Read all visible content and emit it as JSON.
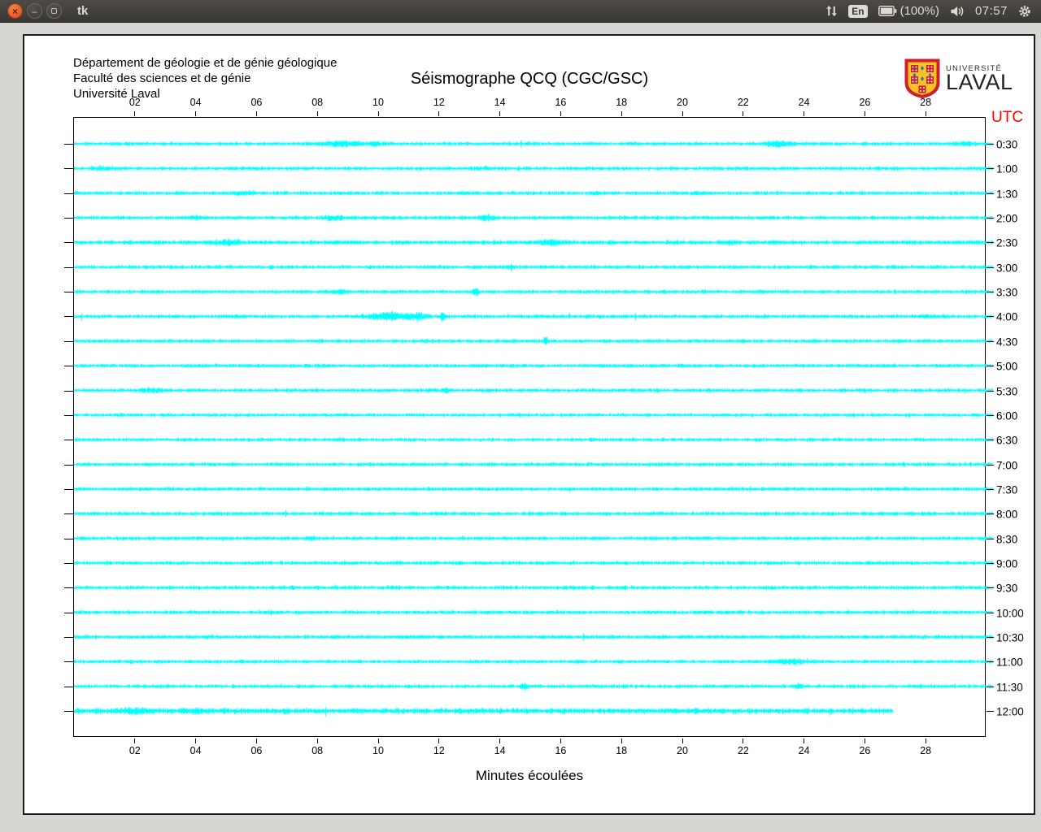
{
  "panel": {
    "title": "tk",
    "indicators": {
      "keyboard": "En",
      "battery": "(100%)",
      "clock": "07:57"
    }
  },
  "header": {
    "line1": "Département de géologie et de génie géologique",
    "line2": "Faculté des sciences et de génie",
    "line3": "Université Laval"
  },
  "logo": {
    "line1": "UNIVERSITÉ",
    "line2": "LAVAL"
  },
  "chart_data": {
    "type": "line",
    "title": "Séismographe QCQ (CGC/GSC)",
    "xlabel": "Minutes écoulées",
    "right_axis_label": "UTC",
    "right_axis_label_color": "#ff0000",
    "x_range": [
      0,
      30
    ],
    "trace_color": "#00ffff",
    "x_ticks": [
      {
        "m": 2,
        "label": "02"
      },
      {
        "m": 4,
        "label": "04"
      },
      {
        "m": 6,
        "label": "06"
      },
      {
        "m": 8,
        "label": "08"
      },
      {
        "m": 10,
        "label": "10"
      },
      {
        "m": 12,
        "label": "12"
      },
      {
        "m": 14,
        "label": "14"
      },
      {
        "m": 16,
        "label": "16"
      },
      {
        "m": 18,
        "label": "18"
      },
      {
        "m": 20,
        "label": "20"
      },
      {
        "m": 22,
        "label": "22"
      },
      {
        "m": 24,
        "label": "24"
      },
      {
        "m": 26,
        "label": "26"
      },
      {
        "m": 28,
        "label": "28"
      }
    ],
    "traces": [
      {
        "label": "0:30",
        "end": 30.2,
        "scale": 1,
        "events": [
          [
            8.7,
            3,
            0.5
          ],
          [
            9.9,
            2,
            0.25
          ],
          [
            23.2,
            3,
            0.4
          ],
          [
            29.3,
            2,
            0.25
          ]
        ]
      },
      {
        "label": "1:00",
        "end": 30.2,
        "scale": 1,
        "events": [
          [
            1.0,
            1.5,
            0.3
          ],
          [
            13.5,
            1.2,
            0.2
          ]
        ]
      },
      {
        "label": "1:30",
        "end": 30.2,
        "scale": 1,
        "events": [
          [
            5.6,
            2,
            0.25
          ],
          [
            17.2,
            1.5,
            0.15
          ],
          [
            20.6,
            1.5,
            0.15
          ]
        ]
      },
      {
        "label": "2:00",
        "end": 30.2,
        "scale": 1,
        "events": [
          [
            4.0,
            2,
            0.2
          ],
          [
            8.5,
            2.5,
            0.25
          ],
          [
            13.6,
            2.5,
            0.2
          ]
        ]
      },
      {
        "label": "2:30",
        "end": 30.2,
        "scale": 1.1,
        "events": [
          [
            5.0,
            2.5,
            0.3
          ],
          [
            8.6,
            1.5,
            0.2
          ],
          [
            15.7,
            3.5,
            0.3
          ],
          [
            21.5,
            1.5,
            0.2
          ]
        ]
      },
      {
        "label": "3:00",
        "end": 30.2,
        "scale": 1,
        "events": [
          [
            14.3,
            1.5,
            0.15
          ]
        ]
      },
      {
        "label": "3:30",
        "end": 30.2,
        "scale": 1,
        "events": [
          [
            8.7,
            2,
            0.2
          ],
          [
            13.2,
            7,
            0.06
          ]
        ]
      },
      {
        "label": "4:00",
        "end": 30.2,
        "scale": 1,
        "events": [
          [
            10.3,
            5,
            0.45
          ],
          [
            11.3,
            5,
            0.2
          ],
          [
            12.1,
            6,
            0.05
          ],
          [
            28.0,
            2,
            0.15
          ]
        ]
      },
      {
        "label": "4:30",
        "end": 30.2,
        "scale": 1,
        "events": [
          [
            15.5,
            7,
            0.05
          ]
        ]
      },
      {
        "label": "5:00",
        "end": 30.2,
        "scale": 1,
        "events": []
      },
      {
        "label": "5:30",
        "end": 30.2,
        "scale": 1,
        "events": [
          [
            2.4,
            2.5,
            0.3
          ],
          [
            12.2,
            1.8,
            0.15
          ]
        ]
      },
      {
        "label": "6:00",
        "end": 30.2,
        "scale": 0.95,
        "events": []
      },
      {
        "label": "6:30",
        "end": 30.2,
        "scale": 0.95,
        "events": []
      },
      {
        "label": "7:00",
        "end": 30.2,
        "scale": 1,
        "events": []
      },
      {
        "label": "7:30",
        "end": 30.2,
        "scale": 1,
        "events": []
      },
      {
        "label": "8:00",
        "end": 30.2,
        "scale": 1.05,
        "events": []
      },
      {
        "label": "8:30",
        "end": 30.2,
        "scale": 1,
        "events": [
          [
            7.8,
            1.5,
            0.15
          ]
        ]
      },
      {
        "label": "9:00",
        "end": 30.2,
        "scale": 1,
        "events": []
      },
      {
        "label": "9:30",
        "end": 30.2,
        "scale": 1,
        "events": []
      },
      {
        "label": "10:00",
        "end": 30.2,
        "scale": 1,
        "events": []
      },
      {
        "label": "10:30",
        "end": 30.2,
        "scale": 1.05,
        "events": []
      },
      {
        "label": "11:00",
        "end": 30.2,
        "scale": 1,
        "events": [
          [
            23.5,
            3,
            0.35
          ]
        ]
      },
      {
        "label": "11:30",
        "end": 30.2,
        "scale": 1,
        "events": [
          [
            14.8,
            4,
            0.07
          ],
          [
            23.8,
            2.5,
            0.15
          ]
        ]
      },
      {
        "label": "12:00",
        "end": 26.9,
        "scale": 1.5,
        "events": [
          [
            2.0,
            2,
            0.3
          ],
          [
            4.0,
            2,
            0.25
          ]
        ]
      }
    ]
  }
}
